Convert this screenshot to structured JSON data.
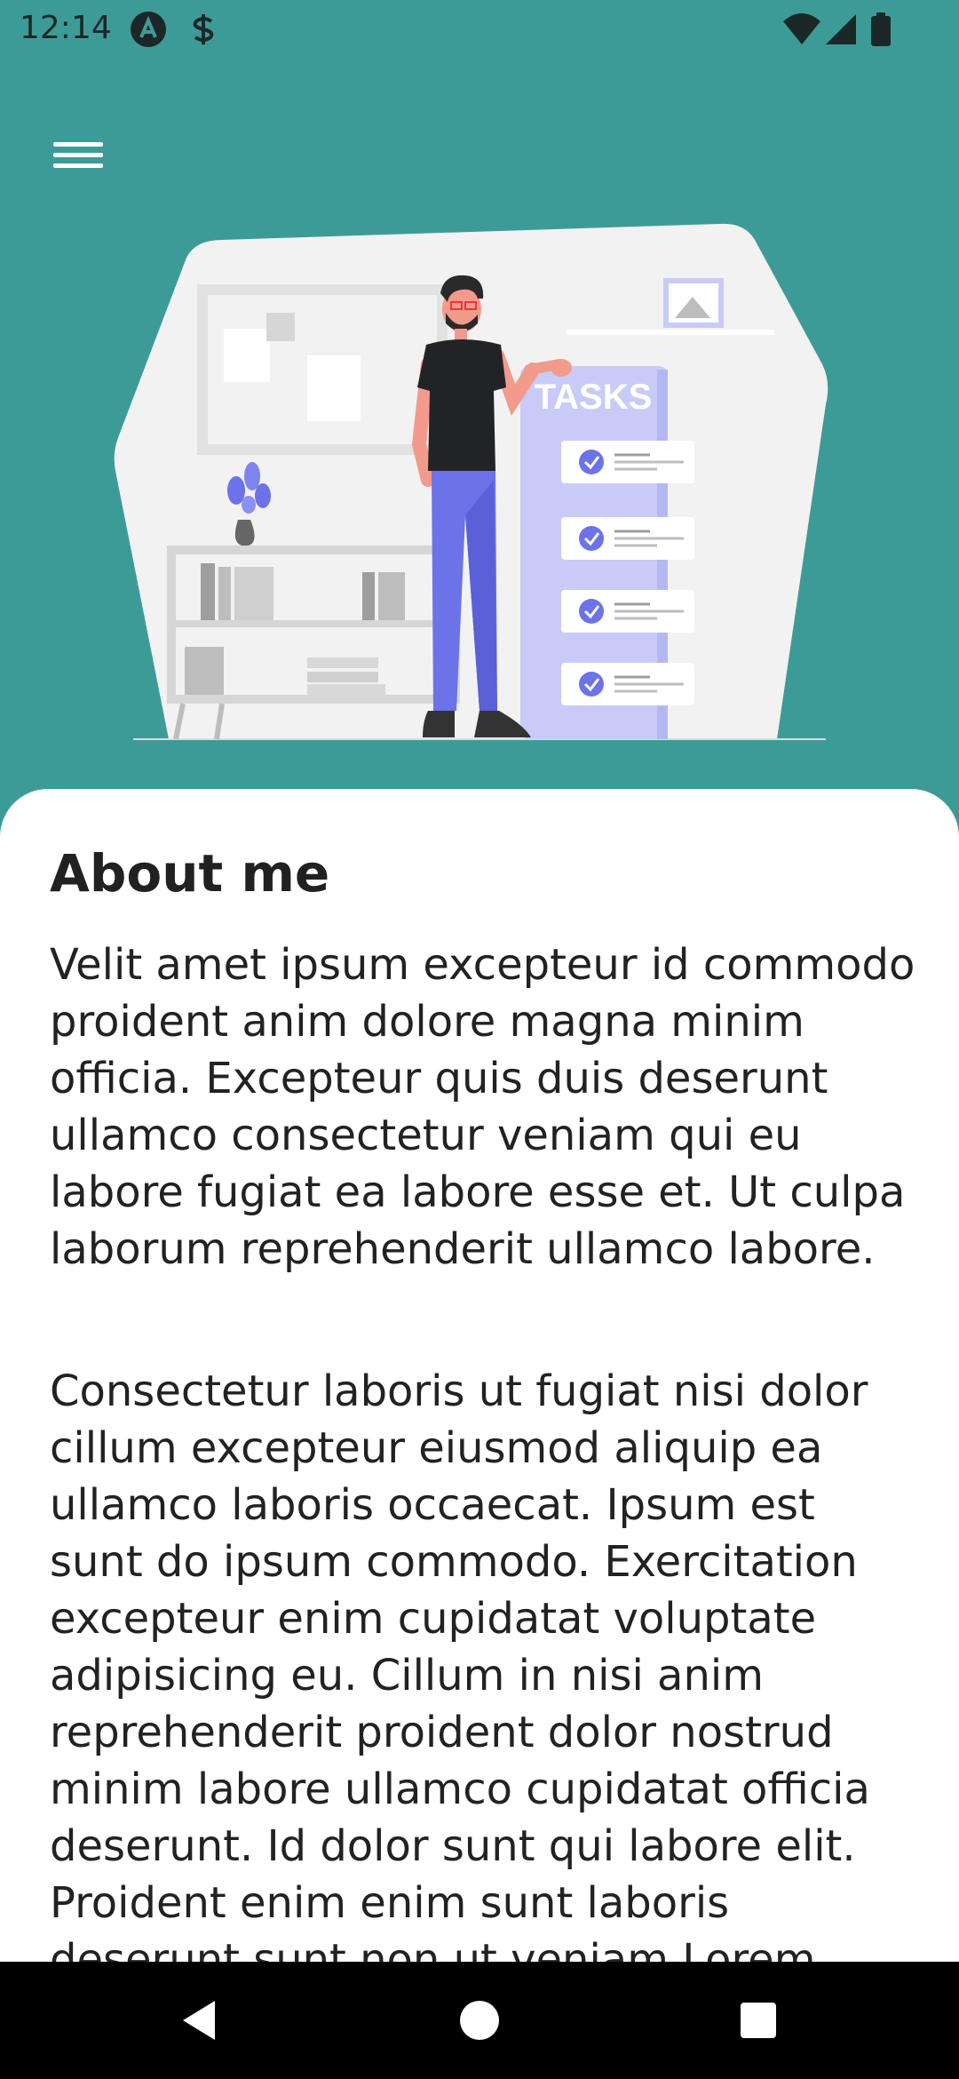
{
  "status_bar": {
    "time": "12:14",
    "left_icons": [
      "app-a-icon",
      "app-s-icon"
    ],
    "right_icons": [
      "wifi-icon",
      "cellular-signal-icon",
      "battery-icon"
    ]
  },
  "header": {
    "menu_icon": "hamburger-menu-icon",
    "background_color": "#3D9B97"
  },
  "illustration": {
    "panel_title": "TASKS",
    "task_count": 4
  },
  "about": {
    "title": "About me",
    "paragraph_1": "Velit amet ipsum excepteur id commodo proident anim dolore magna minim officia. Excepteur quis duis deserunt ullamco consectetur veniam qui eu labore fugiat ea labore esse et. Ut culpa laborum reprehenderit ullamco labore.",
    "paragraph_2": "Consectetur laboris ut fugiat nisi dolor cillum excepteur eiusmod aliquip ea ullamco laboris occaecat. Ipsum est sunt do ipsum commodo. Exercitation excepteur enim cupidatat voluptate adipisicing eu. Cillum in nisi anim reprehenderit proident dolor nostrud minim labore ullamco cupidatat officia deserunt. Id dolor sunt qui labore elit. Proident enim enim sunt laboris deserunt sunt non ut veniam Lorem"
  },
  "nav_bar": {
    "buttons": [
      "back-icon",
      "home-icon",
      "recents-icon"
    ]
  },
  "colors": {
    "accent": "#3D9B97",
    "panel": "#C8CBF7",
    "figure_pants": "#6C72E8"
  }
}
